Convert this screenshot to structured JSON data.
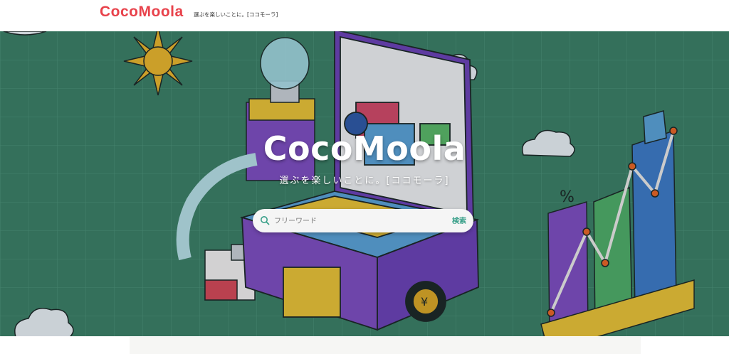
{
  "header": {
    "logo_text": "CocoMoola",
    "tagline": "選ぶを楽しいことに。[ココモーラ]"
  },
  "hero": {
    "title": "CocoMoola",
    "subtitle": "選ぶを楽しいことに。[ココモーラ]",
    "background": "isometric-laptop-city-illustration"
  },
  "search": {
    "placeholder": "フリーワード",
    "button_label": "検索",
    "icon": "search-icon"
  },
  "colors": {
    "brand_red": "#e8424b",
    "hero_green": "#3c8068",
    "search_accent": "#3aa08a"
  }
}
